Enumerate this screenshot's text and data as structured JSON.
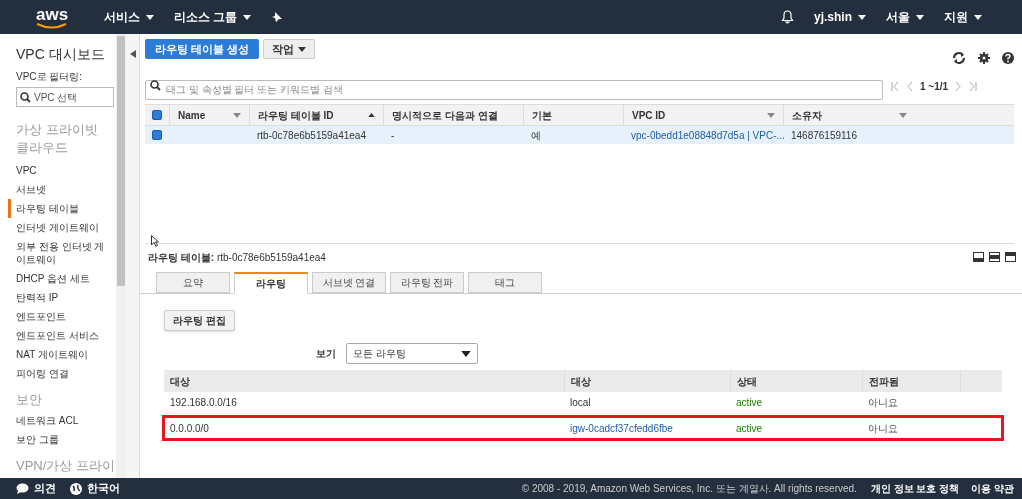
{
  "top_nav": {
    "logo": "aws",
    "menus": [
      "서비스",
      "리소스 그룹"
    ],
    "user": "yj.shin",
    "region": "서울",
    "support": "지원"
  },
  "sidebar": {
    "title": "VPC 대시보드",
    "filter_label": "VPC로 필터링:",
    "filter_placeholder": "VPC 선택",
    "sections": [
      {
        "heading": "가상 프라이빗 클라우드",
        "items": [
          {
            "label": "VPC",
            "selected": false
          },
          {
            "label": "서브넷",
            "selected": false
          },
          {
            "label": "라우팅 테이블",
            "selected": true
          },
          {
            "label": "인터넷 게이트웨이",
            "selected": false
          },
          {
            "label": "외부 전용 인터넷 게이트웨이",
            "selected": false
          },
          {
            "label": "DHCP 옵션 세트",
            "selected": false
          },
          {
            "label": "탄력적 IP",
            "selected": false
          },
          {
            "label": "엔드포인트",
            "selected": false
          },
          {
            "label": "엔드포인트 서비스",
            "selected": false
          },
          {
            "label": "NAT 게이트웨이",
            "selected": false
          },
          {
            "label": "피어링 연결",
            "selected": false
          }
        ]
      },
      {
        "heading": "보안",
        "items": [
          {
            "label": "네트워크 ACL",
            "selected": false
          },
          {
            "label": "보안 그룹",
            "selected": false
          }
        ]
      },
      {
        "heading": "VPN/가상 프라이"
      }
    ]
  },
  "toolbar": {
    "create_button": "라우팅 테이블 생성",
    "actions_button": "작업"
  },
  "search": {
    "placeholder": "태그 및 속성별 필터 또는 키워드별 검색"
  },
  "pagination": "1 ~1/1",
  "table": {
    "header_checked": true,
    "columns": [
      "Name",
      "라우팅 테이블 ID",
      "명시적으로 다음과 연결",
      "기본",
      "VPC ID",
      "소유자"
    ],
    "rows": [
      {
        "selected": true,
        "cells": [
          "",
          "rtb-0c78e6b5159a41ea4",
          "-",
          "예",
          "vpc-0bedd1e08848d7d5a | VPC-...",
          "146876159116"
        ]
      }
    ]
  },
  "details": {
    "label": "라우팅 테이블:",
    "value": "rtb-0c78e6b5159a41ea4",
    "tabs": [
      {
        "label": "요약",
        "selected": false
      },
      {
        "label": "라우팅",
        "selected": true
      },
      {
        "label": "서브넷 연결",
        "selected": false
      },
      {
        "label": "라우팅 전파",
        "selected": false
      },
      {
        "label": "태그",
        "selected": false
      }
    ],
    "edit_button": "라우팅 편집",
    "view_label": "보기",
    "view_value": "모든 라우팅",
    "routes_columns": [
      "대상",
      "대상",
      "상태",
      "전파됨"
    ],
    "routes": [
      {
        "destination": "192.168.0.0/16",
        "target": "local",
        "target_link": false,
        "status": "active",
        "propagated": "아니요",
        "highlighted": false
      },
      {
        "destination": "0.0.0.0/0",
        "target": "igw-0cadcf37cfedd6fbe",
        "target_link": true,
        "status": "active",
        "propagated": "아니요",
        "highlighted": true
      }
    ]
  },
  "footer": {
    "feedback": "의견",
    "language": "한국어",
    "copyright": "© 2008 - 2019, Amazon Web Services, Inc. 또는 계열사. All rights reserved.",
    "links": [
      "개인 정보 보호 정책",
      "이용 약관"
    ]
  }
}
